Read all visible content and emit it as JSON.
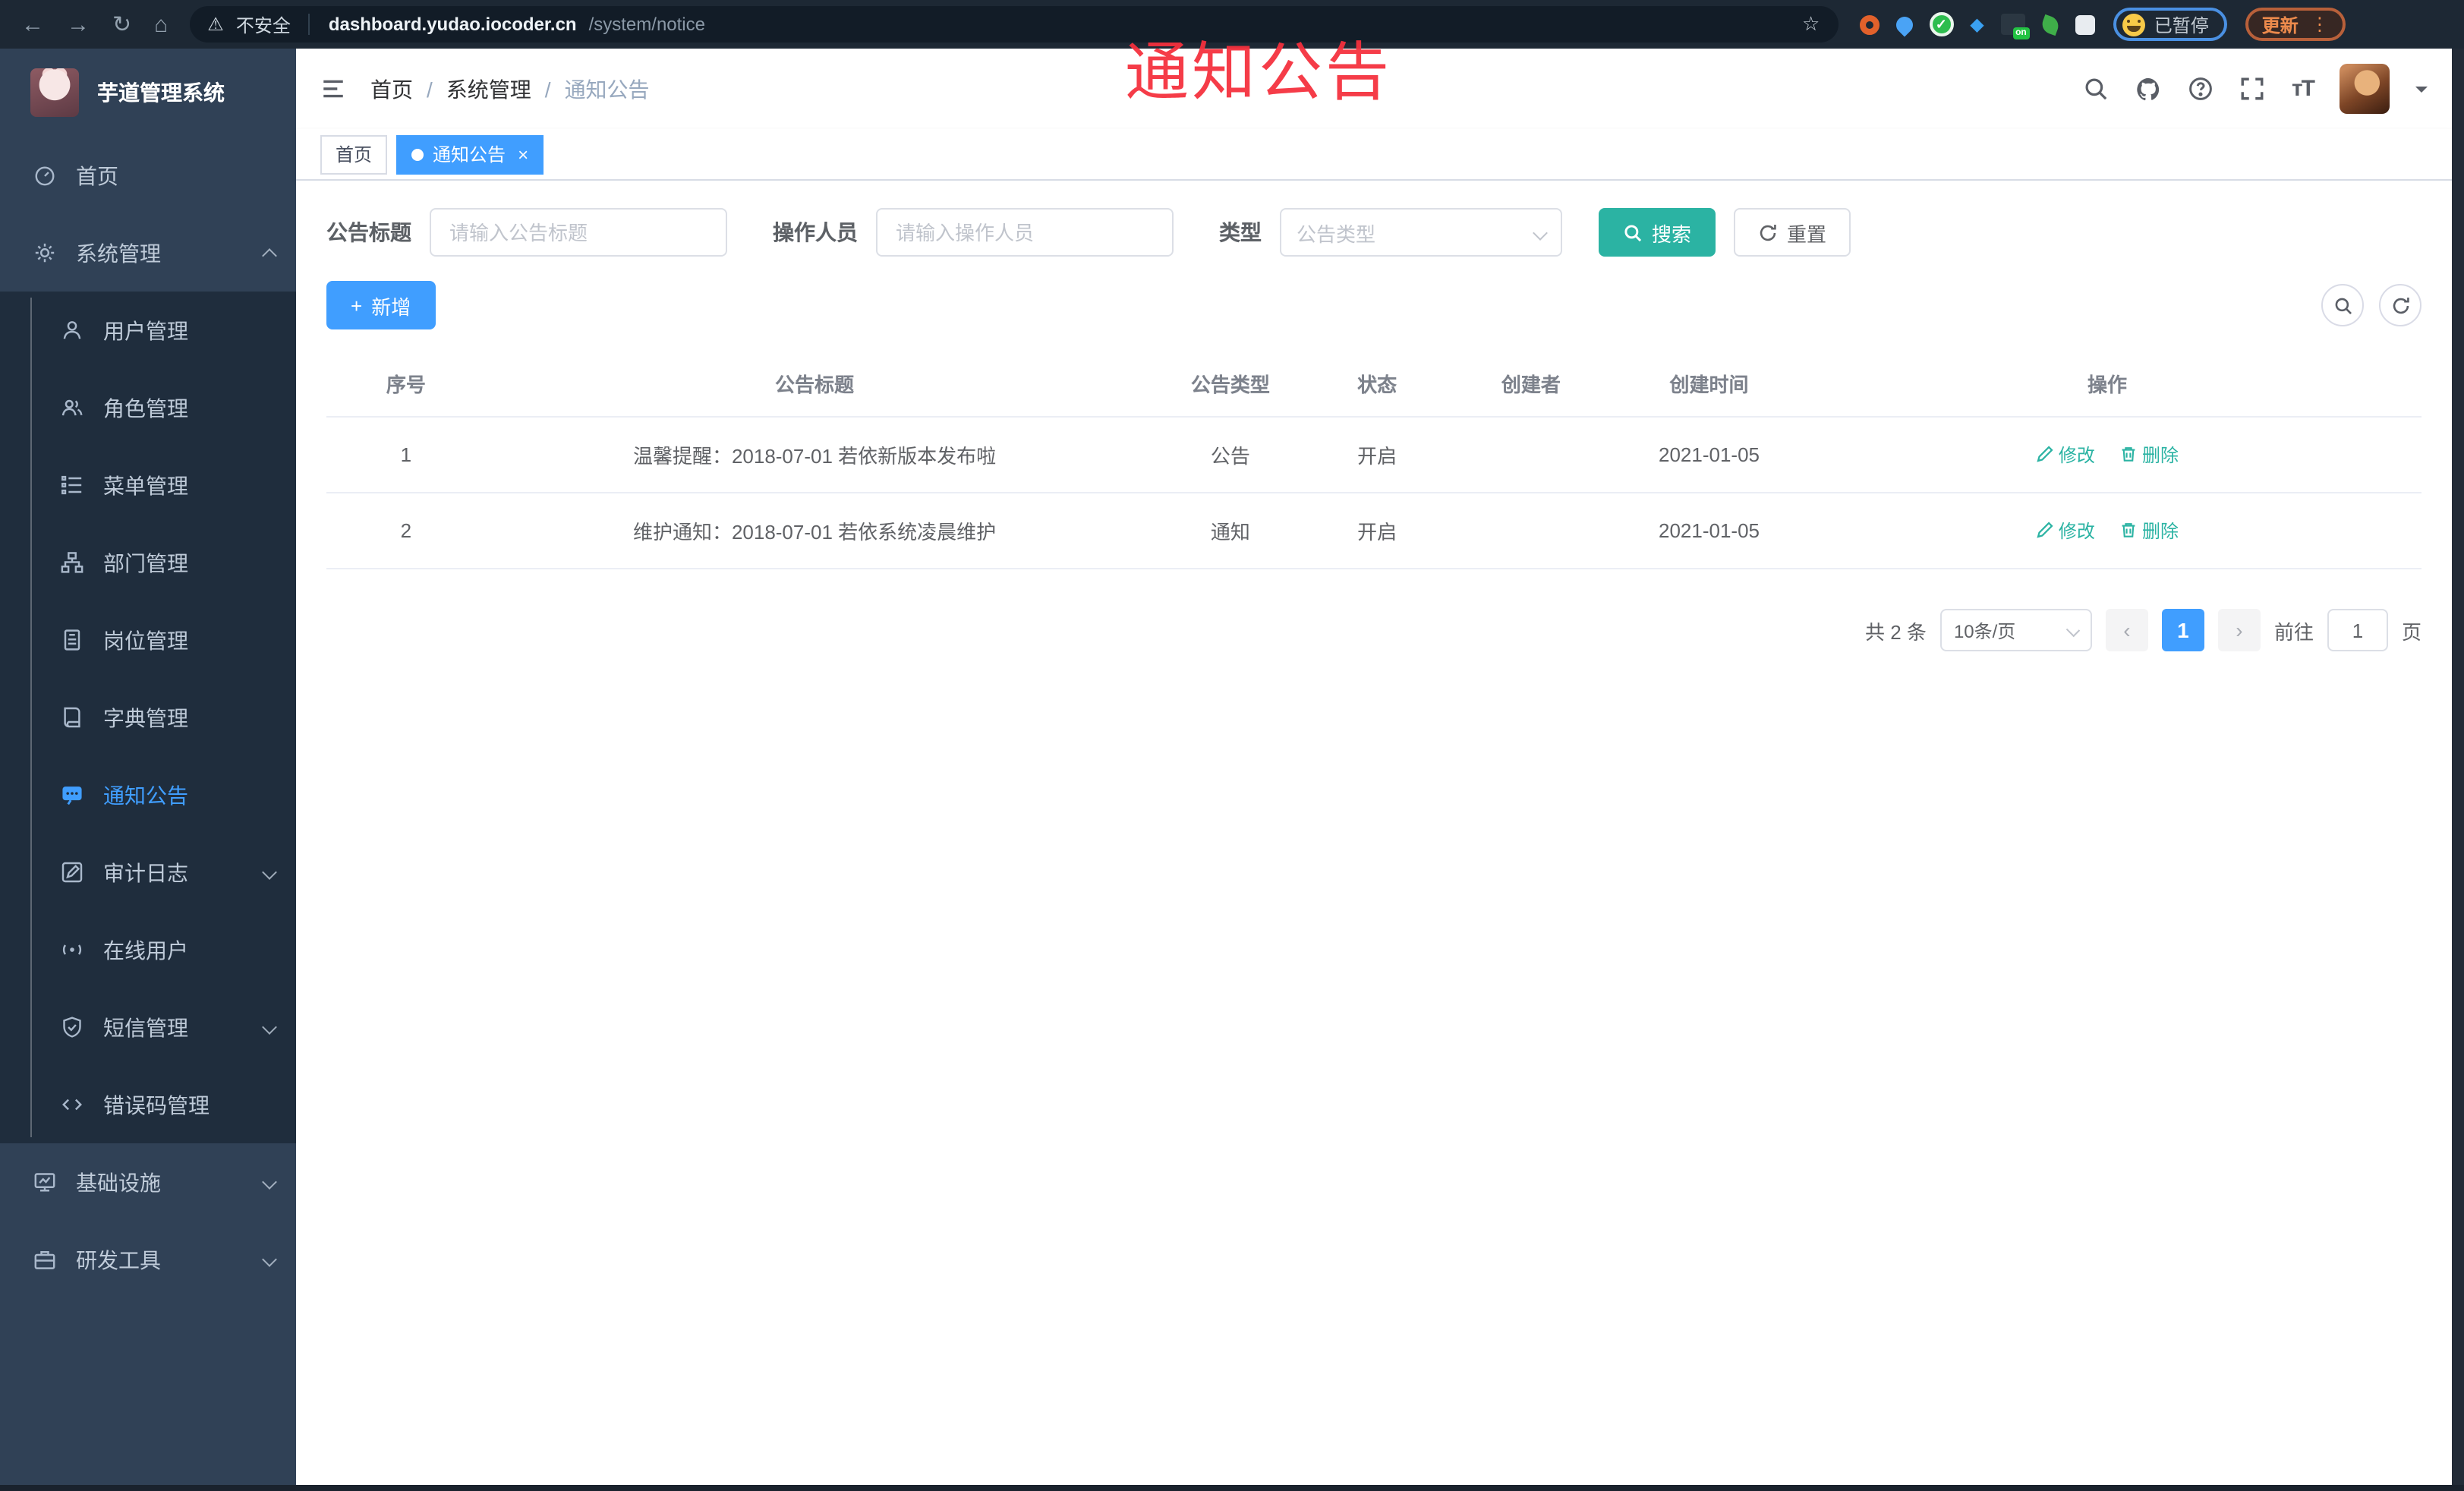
{
  "colors": {
    "accent": "#409eff",
    "theme": "#2bb3a3",
    "red": "#f5303d",
    "sidebarBg": "#304156",
    "submenuBg": "#1f2d3d",
    "browserBg": "#1d2834"
  },
  "overlay": {
    "title": "通知公告"
  },
  "browser": {
    "security_label": "不安全",
    "warn_icon": "⚠",
    "url_host": "dashboard.yudao.iocoder.cn",
    "url_path": "/system/notice",
    "back_icon": "←",
    "forward_icon": "→",
    "reload_icon": "↻",
    "home_icon": "⌂",
    "star_icon": "☆",
    "ext_on_badge": "on",
    "ext_green_glyph": "✓",
    "ext_diamond_glyph": "◆",
    "paused_label": "已暂停",
    "update_label": "更新",
    "kebab_icon": "⋮"
  },
  "sidebar": {
    "app_title": "芋道管理系统",
    "menu": [
      {
        "label": "首页",
        "icon": "dashboard",
        "top": true
      },
      {
        "label": "系统管理",
        "icon": "gear",
        "top": true,
        "chev": "up",
        "children": [
          {
            "label": "用户管理",
            "icon": "user"
          },
          {
            "label": "角色管理",
            "icon": "users"
          },
          {
            "label": "菜单管理",
            "icon": "menu"
          },
          {
            "label": "部门管理",
            "icon": "tree"
          },
          {
            "label": "岗位管理",
            "icon": "badge"
          },
          {
            "label": "字典管理",
            "icon": "book"
          },
          {
            "label": "通知公告",
            "icon": "chat",
            "active": true
          },
          {
            "label": "审计日志",
            "icon": "log",
            "chev": "down"
          },
          {
            "label": "在线用户",
            "icon": "online"
          },
          {
            "label": "短信管理",
            "icon": "shield",
            "chev": "down"
          },
          {
            "label": "错误码管理",
            "icon": "code"
          }
        ]
      },
      {
        "label": "基础设施",
        "icon": "monitor",
        "top": true,
        "chev": "down"
      },
      {
        "label": "研发工具",
        "icon": "tools",
        "top": true,
        "chev": "down"
      }
    ]
  },
  "navbar": {
    "breadcrumb": [
      {
        "label": "首页"
      },
      {
        "label": "系统管理"
      },
      {
        "label": "通知公告",
        "current": true
      }
    ]
  },
  "tabsbar": {
    "tabs": [
      {
        "label": "首页"
      },
      {
        "label": "通知公告",
        "active": true,
        "closable": true
      }
    ],
    "close_icon": "×"
  },
  "filters": {
    "title_label": "公告标题",
    "title_placeholder": "请输入公告标题",
    "operator_label": "操作人员",
    "operator_placeholder": "请输入操作人员",
    "type_label": "类型",
    "type_placeholder": "公告类型",
    "search_label": "搜索",
    "reset_label": "重置"
  },
  "toolbar": {
    "add_label": "新增",
    "plus_icon": "+"
  },
  "table": {
    "columns": [
      {
        "label": "序号",
        "width": "7.6%"
      },
      {
        "label": "公告标题",
        "width": "31.4%"
      },
      {
        "label": "公告类型",
        "width": "8.3%"
      },
      {
        "label": "状态",
        "width": "5.7%"
      },
      {
        "label": "创建者",
        "width": "9%"
      },
      {
        "label": "创建时间",
        "width": "8%"
      },
      {
        "label": "操作",
        "width": "30%"
      }
    ],
    "rows": [
      {
        "no": "1",
        "title": "温馨提醒：2018-07-01 若依新版本发布啦",
        "type": "公告",
        "status": "开启",
        "creator": "",
        "created": "2021-01-05"
      },
      {
        "no": "2",
        "title": "维护通知：2018-07-01 若依系统凌晨维护",
        "type": "通知",
        "status": "开启",
        "creator": "",
        "created": "2021-01-05"
      }
    ],
    "edit_label": "修改",
    "delete_label": "删除"
  },
  "pagination": {
    "total_label": "共 2 条",
    "page_size_label": "10条/页",
    "prev_icon": "‹",
    "next_icon": "›",
    "current_page": "1",
    "goto_label": "前往",
    "goto_value": "1",
    "page_unit_label": "页"
  }
}
